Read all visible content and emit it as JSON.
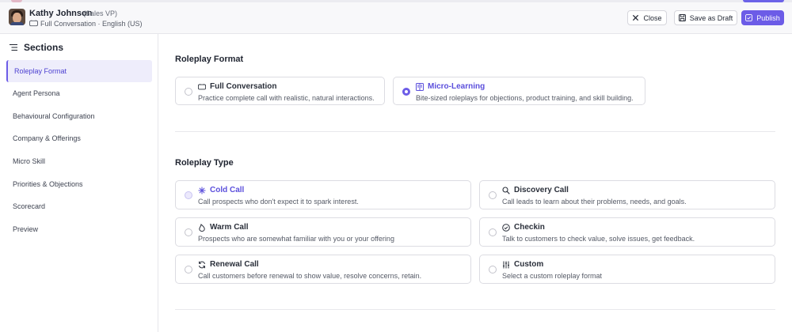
{
  "header": {
    "user_name": "Kathy Johnson",
    "user_role": "(Sales VP)",
    "user_meta": "Full Conversation · English (US)",
    "buttons": {
      "close": "Close",
      "save_draft": "Save as Draft",
      "publish": "Publish"
    }
  },
  "sidebar": {
    "title": "Sections",
    "items": [
      {
        "label": "Roleplay Format",
        "active": true
      },
      {
        "label": "Agent Persona",
        "active": false
      },
      {
        "label": "Behavioural Configuration",
        "active": false
      },
      {
        "label": "Company & Offerings",
        "active": false
      },
      {
        "label": "Micro Skill",
        "active": false
      },
      {
        "label": "Priorities & Objections",
        "active": false
      },
      {
        "label": "Scorecard",
        "active": false
      },
      {
        "label": "Preview",
        "active": false
      }
    ]
  },
  "roleplay_format": {
    "title": "Roleplay Format",
    "options": [
      {
        "title": "Full Conversation",
        "desc": "Practice complete call with realistic, natural interactions.",
        "icon": "chat-icon",
        "selected": false
      },
      {
        "title": "Micro-Learning",
        "desc": "Bite-sized roleplays for objections, product training, and skill building.",
        "icon": "book-icon",
        "selected": true
      }
    ]
  },
  "roleplay_type": {
    "title": "Roleplay Type",
    "options": [
      {
        "title": "Cold Call",
        "desc": "Call prospects who don't expect it to spark interest.",
        "icon": "snowflake-icon",
        "highlighted": true
      },
      {
        "title": "Discovery Call",
        "desc": "Call leads to learn about their problems, needs, and goals.",
        "icon": "search-icon",
        "highlighted": false
      },
      {
        "title": "Warm Call",
        "desc": "Prospects who are somewhat familiar with you or your offering",
        "icon": "flame-icon",
        "highlighted": false
      },
      {
        "title": "Checkin",
        "desc": "Talk to customers to check value, solve issues, get feedback.",
        "icon": "check-circle-icon",
        "highlighted": false
      },
      {
        "title": "Renewal Call",
        "desc": "Call customers before renewal to show value, resolve concerns, retain.",
        "icon": "refresh-icon",
        "highlighted": false
      },
      {
        "title": "Custom",
        "desc": "Select a custom roleplay format",
        "icon": "sliders-icon",
        "highlighted": false
      }
    ]
  },
  "colors": {
    "accent": "#6c5ce7",
    "accent_text": "#5b4fdc"
  }
}
